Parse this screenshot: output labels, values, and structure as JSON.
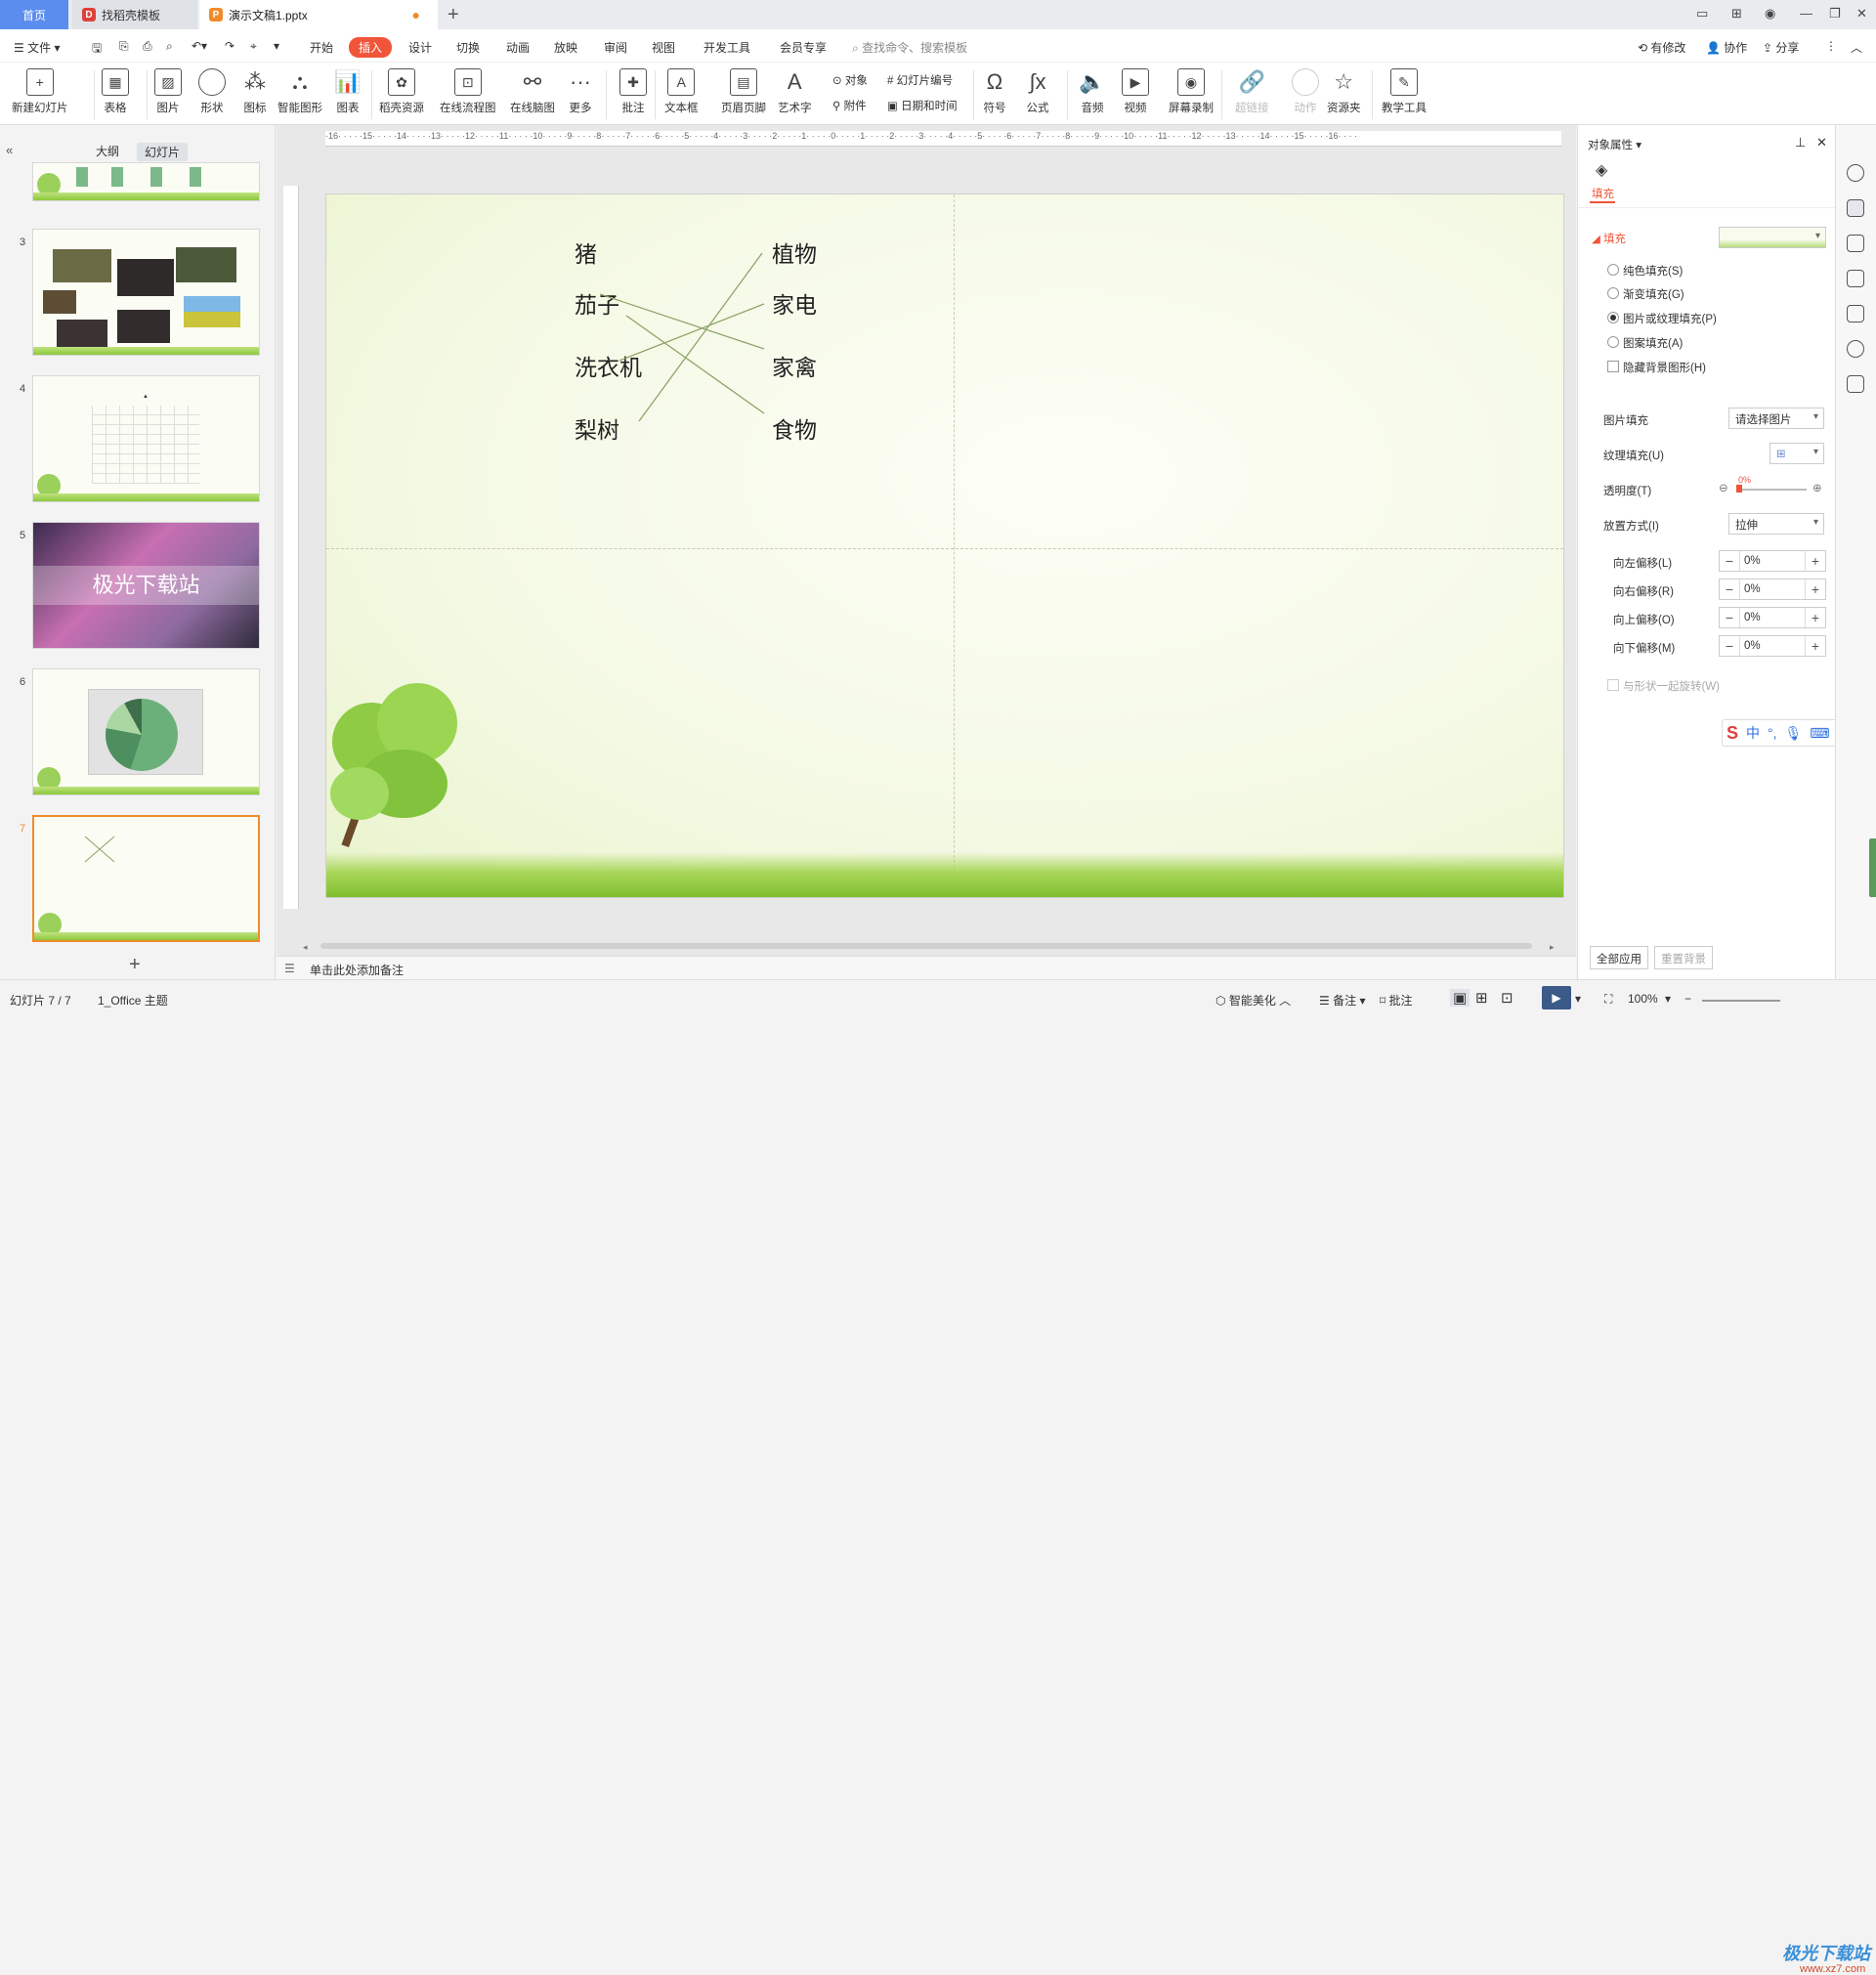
{
  "tabs": {
    "home": "首页",
    "templates": "找稻壳模板",
    "document": "演示文稿1.pptx"
  },
  "menu": {
    "file": "文件",
    "items": [
      "开始",
      "插入",
      "设计",
      "切换",
      "动画",
      "放映",
      "审阅",
      "视图",
      "开发工具",
      "会员专享"
    ],
    "active": "插入",
    "search_placeholder": "查找命令、搜索模板",
    "right": [
      "有修改",
      "协作",
      "分享"
    ]
  },
  "ribbon": {
    "new_slide": "新建幻灯片",
    "table": "表格",
    "picture": "图片",
    "shape": "形状",
    "icon": "图标",
    "smart_shape": "智能图形",
    "chart": "图表",
    "docer_resources": "稻壳资源",
    "online_flowchart": "在线流程图",
    "online_mindmap": "在线脑图",
    "more": "更多",
    "comment": "批注",
    "textbox": "文本框",
    "header_footer": "页眉页脚",
    "wordart": "艺术字",
    "object": "对象",
    "slide_number": "幻灯片编号",
    "attachment": "附件",
    "date_time": "日期和时间",
    "symbol": "符号",
    "formula": "公式",
    "audio": "音频",
    "video": "视频",
    "screen_record": "屏幕录制",
    "hyperlink": "超链接",
    "action": "动作",
    "resource_folder": "资源夹",
    "teaching_tools": "教学工具"
  },
  "left_panel": {
    "tab_outline": "大纲",
    "tab_slides": "幻灯片",
    "slide_numbers": [
      "3",
      "4",
      "5",
      "6",
      "7"
    ],
    "slide5_text": "极光下载站",
    "slide4_marker": "▲",
    "add_slide": "+"
  },
  "slide": {
    "left_words": [
      "猪",
      "茄子",
      "洗衣机",
      "梨树"
    ],
    "right_words": [
      "植物",
      "家电",
      "家禽",
      "食物"
    ]
  },
  "notes": {
    "placeholder": "单击此处添加备注"
  },
  "properties": {
    "title": "对象属性",
    "tab_fill": "填充",
    "section_fill": "填充",
    "options": [
      "纯色填充(S)",
      "渐变填充(G)",
      "图片或纹理填充(P)",
      "图案填充(A)"
    ],
    "selected_option": "图片或纹理填充(P)",
    "hide_bg": "隐藏背景图形(H)",
    "picture_fill_label": "图片填充",
    "picture_fill_value": "请选择图片",
    "texture_fill_label": "纹理填充(U)",
    "transparency_label": "透明度(T)",
    "transparency_value": "0%",
    "placement_label": "放置方式(I)",
    "placement_value": "拉伸",
    "offset_left_label": "向左偏移(L)",
    "offset_right_label": "向右偏移(R)",
    "offset_up_label": "向上偏移(O)",
    "offset_down_label": "向下偏移(M)",
    "offset_left": "0%",
    "offset_right": "0%",
    "offset_up": "0%",
    "offset_down": "0%",
    "rotate_with_shape": "与形状一起旋转(W)",
    "apply_all": "全部应用",
    "reset_bg": "重置背景"
  },
  "status": {
    "slide_counter": "幻灯片 7 / 7",
    "theme": "1_Office 主题",
    "smart_beautify": "智能美化",
    "notes": "备注",
    "comments": "批注",
    "zoom": "100%"
  },
  "watermark": {
    "text": "极光下载站",
    "url": "www.xz7.com"
  },
  "colors": {
    "accent": "#f0553a",
    "home_tab": "#5b8def",
    "selected_thumb": "#f08b2b"
  }
}
